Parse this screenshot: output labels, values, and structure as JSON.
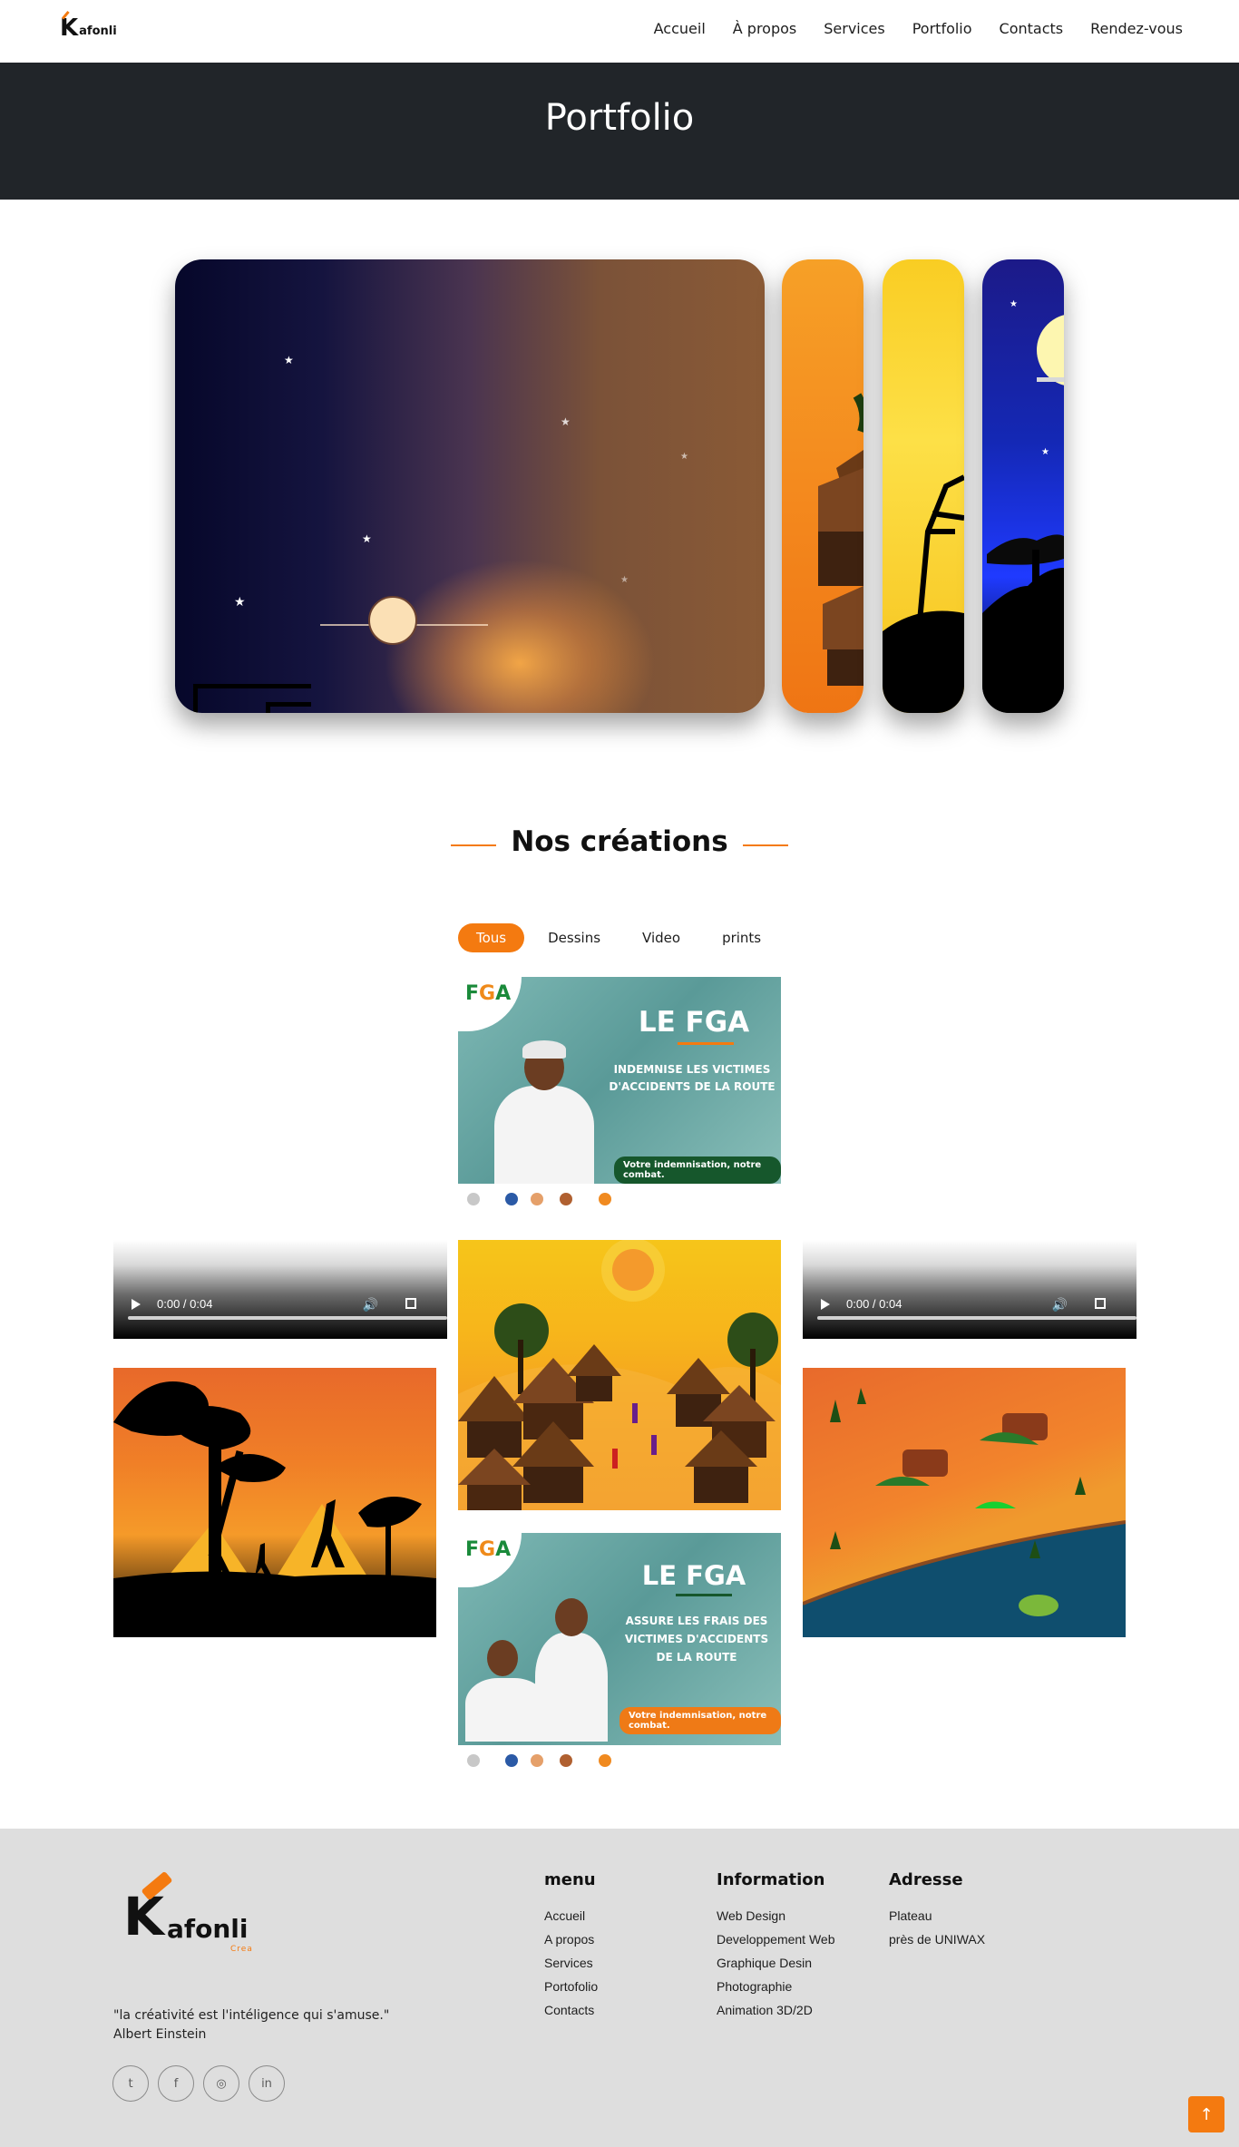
{
  "brand": {
    "name_initial": "K",
    "name_rest": "afonli",
    "tagline": "Crea"
  },
  "nav": {
    "items": [
      "Accueil",
      "À propos",
      "Services",
      "Portfolio",
      "Contacts",
      "Rendez-vous"
    ]
  },
  "hero": {
    "title": "Portfolio"
  },
  "section": {
    "title": "Nos créations"
  },
  "filters": {
    "items": [
      "Tous",
      "Dessins",
      "Video",
      "prints"
    ],
    "active": "Tous"
  },
  "fga1": {
    "logo_f": "F",
    "logo_g": "G",
    "logo_a": "A",
    "headline": "LE FGA",
    "subline1": "INDEMNISE LES VICTIMES",
    "subline2": "D'ACCIDENTS DE LA ROUTE",
    "badge": "Votre indemnisation, notre combat."
  },
  "fga2": {
    "logo_f": "F",
    "logo_g": "G",
    "logo_a": "A",
    "headline": "LE FGA",
    "subline1": "ASSURE LES FRAIS DES",
    "subline2": "VICTIMES D'ACCIDENTS",
    "subline3": "DE LA ROUTE",
    "badge": "Votre indemnisation, notre combat."
  },
  "video_left": {
    "time": "0:00 / 0:04"
  },
  "video_right": {
    "time": "0:00 / 0:04"
  },
  "footer": {
    "quote_line1": "\"la créativité est l'intéligence qui s'amuse.\"",
    "quote_line2": "Albert Einstein",
    "menu_title": "menu",
    "menu_items": [
      "Accueil",
      "A propos",
      "Services",
      "Portofolio",
      "Contacts"
    ],
    "info_title": "Information",
    "info_items": [
      "Web Design",
      "Developpement Web",
      "Graphique Desin",
      "Photographie",
      "Animation 3D/2D"
    ],
    "address_title": "Adresse",
    "address_lines": [
      "Plateau",
      "près de UNIWAX"
    ],
    "socials": [
      "twitter-icon",
      "facebook-icon",
      "instagram-icon",
      "linkedin-icon"
    ]
  },
  "colors": {
    "accent": "#f47a10",
    "hero_bg": "#212529",
    "footer_bg": "#dedede"
  }
}
